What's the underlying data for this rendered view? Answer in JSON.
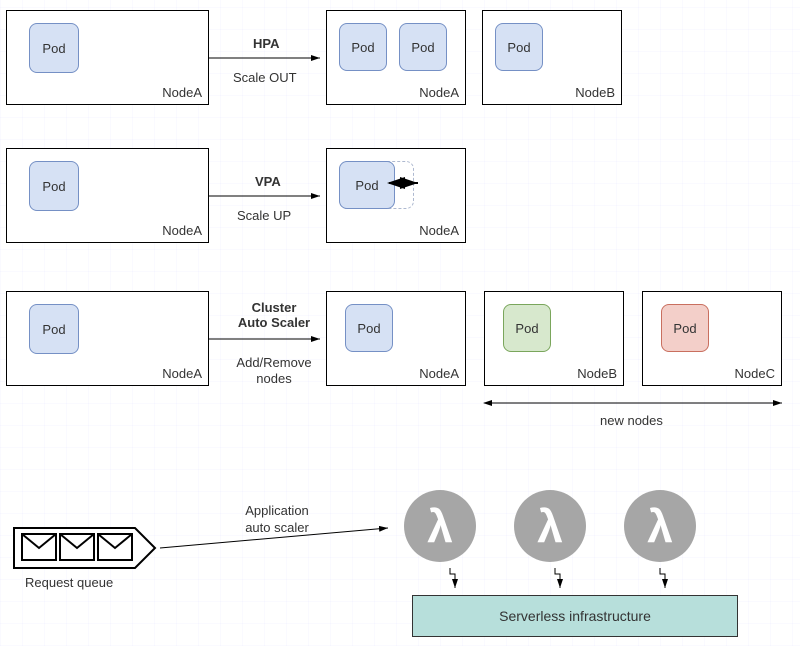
{
  "pod_label": "Pod",
  "row1": {
    "left_node": "NodeA",
    "action_title": "HPA",
    "action_sub": "Scale OUT",
    "right_node_a": "NodeA",
    "right_node_b": "NodeB"
  },
  "row2": {
    "left_node": "NodeA",
    "action_title": "VPA",
    "action_sub": "Scale UP",
    "right_node_a": "NodeA"
  },
  "row3": {
    "left_node": "NodeA",
    "action_title_l1": "Cluster",
    "action_title_l2": "Auto Scaler",
    "action_sub_l1": "Add/Remove",
    "action_sub_l2": "nodes",
    "right_node_a": "NodeA",
    "right_node_b": "NodeB",
    "right_node_c": "NodeC",
    "new_nodes": "new nodes"
  },
  "row4": {
    "queue_label": "Request queue",
    "action_title_l1": "Application",
    "action_title_l2": "auto scaler",
    "infra_label": "Serverless infrastructure"
  }
}
